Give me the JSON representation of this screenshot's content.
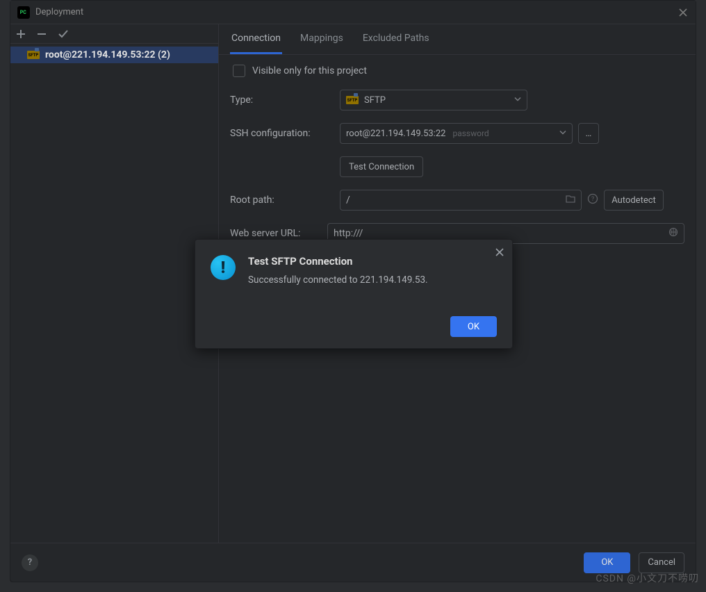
{
  "window": {
    "title": "Deployment"
  },
  "sidebar": {
    "selected_server": "root@221.194.149.53:22 (2)"
  },
  "tabs": {
    "connection": "Connection",
    "mappings": "Mappings",
    "excluded": "Excluded Paths"
  },
  "form": {
    "visible_only_label": "Visible only for this project",
    "type_label": "Type:",
    "type_value": "SFTP",
    "ssh_label": "SSH configuration:",
    "ssh_value": "root@221.194.149.53:22",
    "ssh_hint": "password",
    "test_button": "Test Connection",
    "root_label": "Root path:",
    "root_value": "/",
    "autodetect": "Autodetect",
    "url_label": "Web server URL:",
    "url_value": "http:///"
  },
  "footer": {
    "ok": "OK",
    "cancel": "Cancel"
  },
  "modal": {
    "title": "Test SFTP Connection",
    "message": "Successfully connected to 221.194.149.53.",
    "ok": "OK"
  },
  "watermark": "CSDN @小文刀不唠叨"
}
